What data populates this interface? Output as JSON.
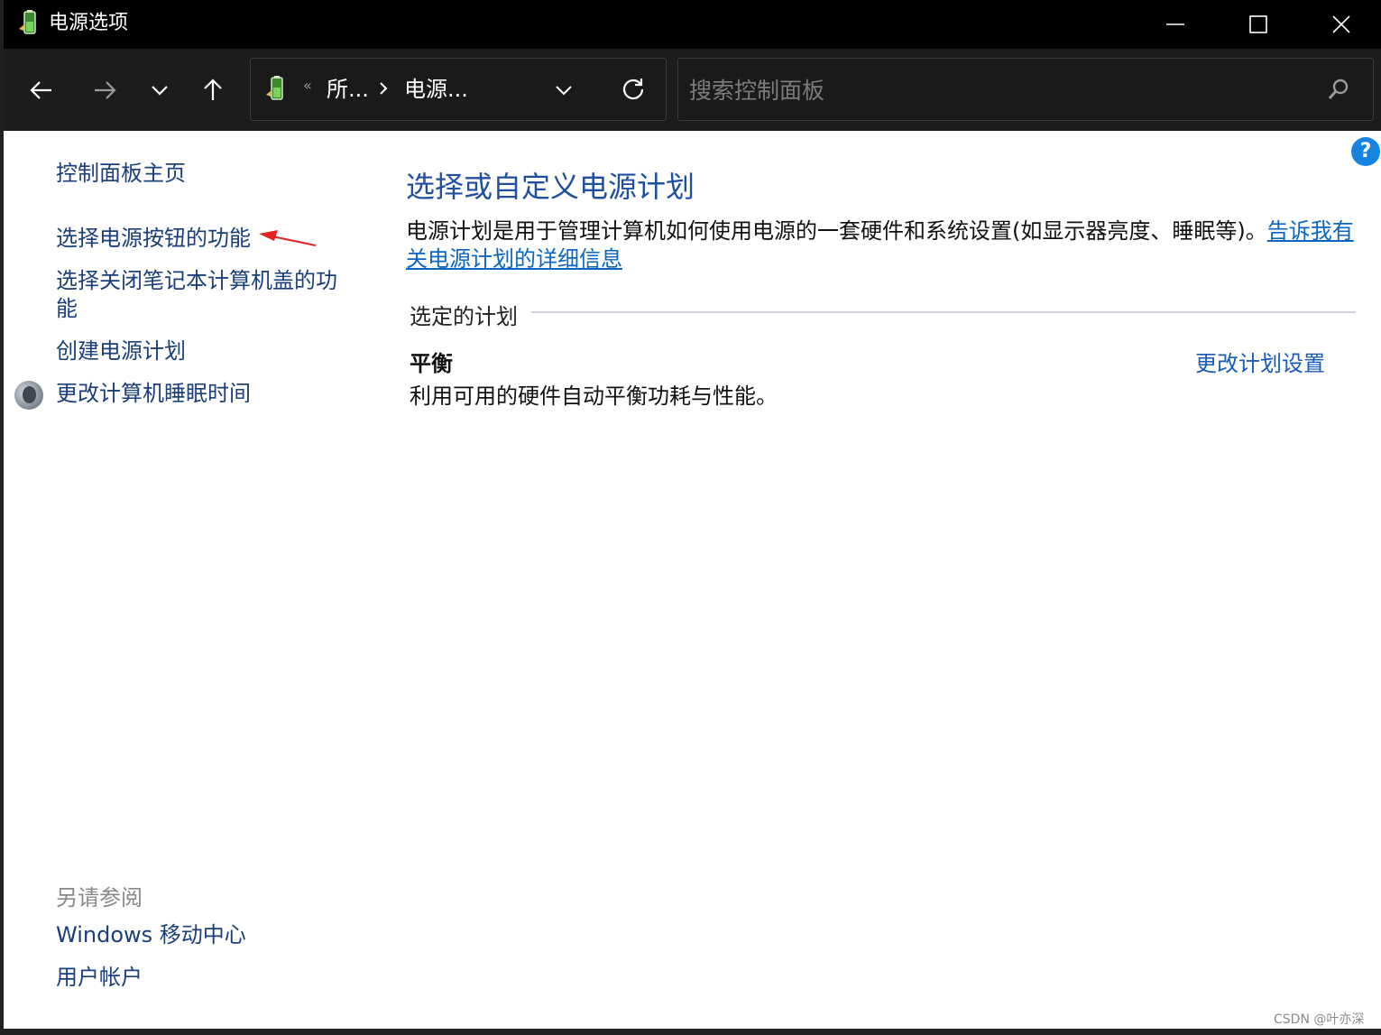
{
  "window": {
    "title": "电源选项",
    "controls": {
      "minimize": "minimize-icon",
      "maximize": "maximize-icon",
      "close": "close-icon"
    }
  },
  "nav": {
    "back": "back-arrow-icon",
    "forward": "forward-arrow-icon",
    "recent": "chevron-down-icon",
    "up": "up-arrow-icon"
  },
  "address": {
    "separator": "«",
    "crumbs": [
      "所...",
      "电源..."
    ]
  },
  "search": {
    "placeholder": "搜索控制面板"
  },
  "sidebar": {
    "home": "控制面板主页",
    "items": [
      "选择电源按钮的功能",
      "选择关闭笔记本计算机盖的功能",
      "创建电源计划",
      "更改计算机睡眠时间"
    ],
    "see_also_title": "另请参阅",
    "see_also": [
      "Windows 移动中心",
      "用户帐户"
    ]
  },
  "main": {
    "title": "选择或自定义电源计划",
    "description": "电源计划是用于管理计算机如何使用电源的一套硬件和系统设置(如显示器亮度、睡眠等)。",
    "description_link": "告诉我有关电源计划的详细信息",
    "section_label": "选定的计划",
    "plan": {
      "name": "平衡",
      "description": "利用可用的硬件自动平衡功耗与性能。",
      "change_link": "更改计划设置"
    },
    "help": "?"
  },
  "watermark": "CSDN @叶亦深",
  "colors": {
    "link": "#1a3f7a",
    "title": "#1e4fa0",
    "accent": "#1683e0",
    "annotation_arrow": "#e52222"
  }
}
